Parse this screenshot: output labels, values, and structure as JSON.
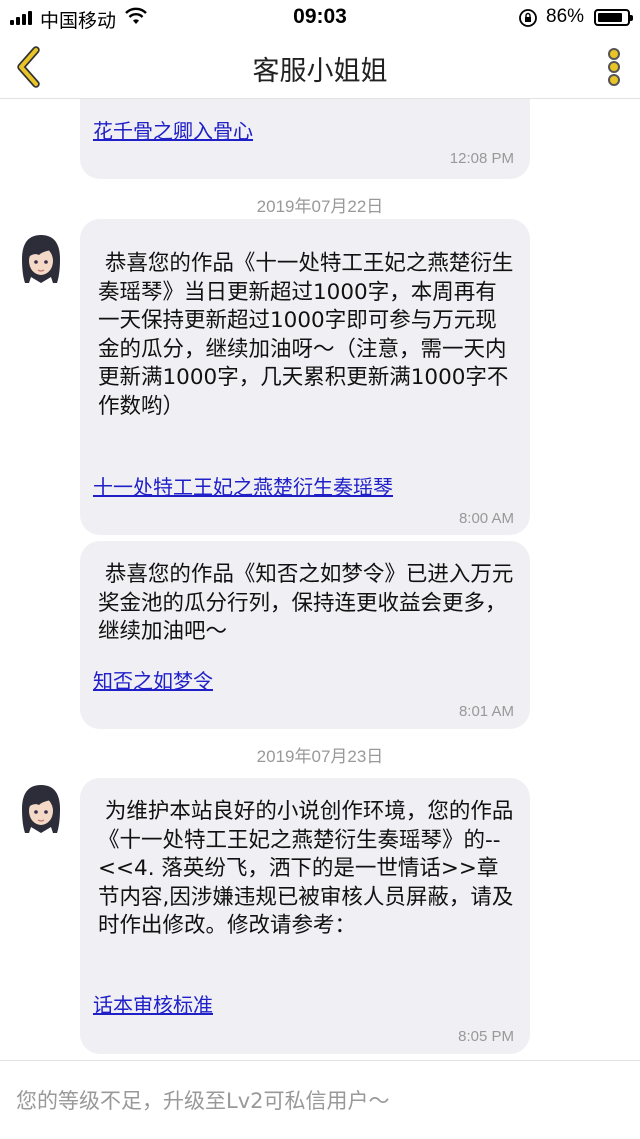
{
  "status_bar": {
    "carrier": "中国移动",
    "time": "09:03",
    "battery": "86%",
    "battery_level": 0.86
  },
  "header": {
    "title": "客服小姐姐"
  },
  "messages": [
    {
      "text": "",
      "link": "花千骨之卿入骨心",
      "time": "12:08 PM",
      "has_avatar": false
    },
    {
      "date": "2019年07月22日"
    },
    {
      "text": " 恭喜您的作品《十一处特工王妃之燕楚衍生奏瑶琴》当日更新超过1000字，本周再有一天保持更新超过1000字即可参与万元现金的瓜分，继续加油呀～（注意，需一天内更新满1000字，几天累积更新满1000字不作数哟）",
      "link": "十一处特工王妃之燕楚衍生奏瑶琴",
      "time": "8:00 AM",
      "has_avatar": true
    },
    {
      "text": " 恭喜您的作品《知否之如梦令》已进入万元奖金池的瓜分行列，保持连更收益会更多，继续加油吧～",
      "link": "知否之如梦令",
      "time": "8:01 AM",
      "has_avatar": false
    },
    {
      "date": "2019年07月23日"
    },
    {
      "text": " 为维护本站良好的小说创作环境，您的作品《十一处特工王妃之燕楚衍生奏瑶琴》的-- <<4. 落英纷飞，洒下的是一世情话>>章节内容,因涉嫌违规已被审核人员屏蔽，请及时作出修改。修改请参考：",
      "link": "话本审核标准",
      "time": "8:05 PM",
      "has_avatar": true
    }
  ],
  "input": {
    "placeholder": "您的等级不足，升级至Lv2可私信用户～"
  },
  "icons": {
    "back": "chevron-left-icon",
    "more": "more-vertical-icon",
    "avatar": "avatar-icon"
  },
  "colors": {
    "accent": "#e9c427",
    "bubble": "#efeff4",
    "link": "#2020c8"
  }
}
